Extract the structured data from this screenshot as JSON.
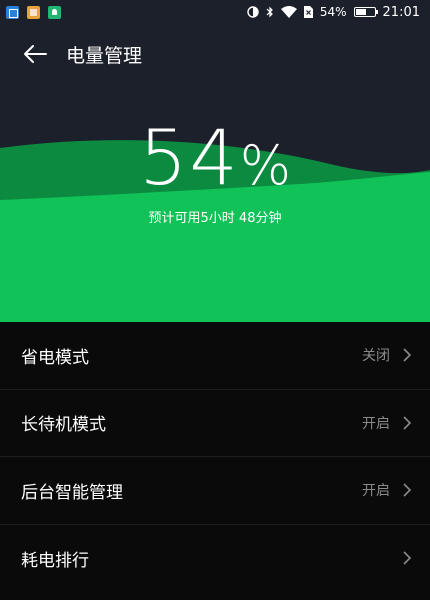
{
  "status_bar": {
    "battery_text": "54%",
    "time": "21:01",
    "notification_icons": [
      "photo-app-icon",
      "message-app-icon",
      "alert-app-icon"
    ]
  },
  "app_bar": {
    "title": "电量管理"
  },
  "battery": {
    "percent_number": "54",
    "percent_sign": "%",
    "remaining_text": "预计可用5小时 48分钟",
    "level": 0.54
  },
  "settings": {
    "items": [
      {
        "label": "省电模式",
        "value": "关闭"
      },
      {
        "label": "长待机模式",
        "value": "开启"
      },
      {
        "label": "后台智能管理",
        "value": "开启"
      },
      {
        "label": "耗电排行",
        "value": ""
      }
    ]
  },
  "colors": {
    "header_bg": "#1c202a",
    "wave_dark": "#0b8a40",
    "wave_light": "#10c257",
    "list_bg": "#0a0a0a",
    "value_text": "#8a8a8a"
  }
}
